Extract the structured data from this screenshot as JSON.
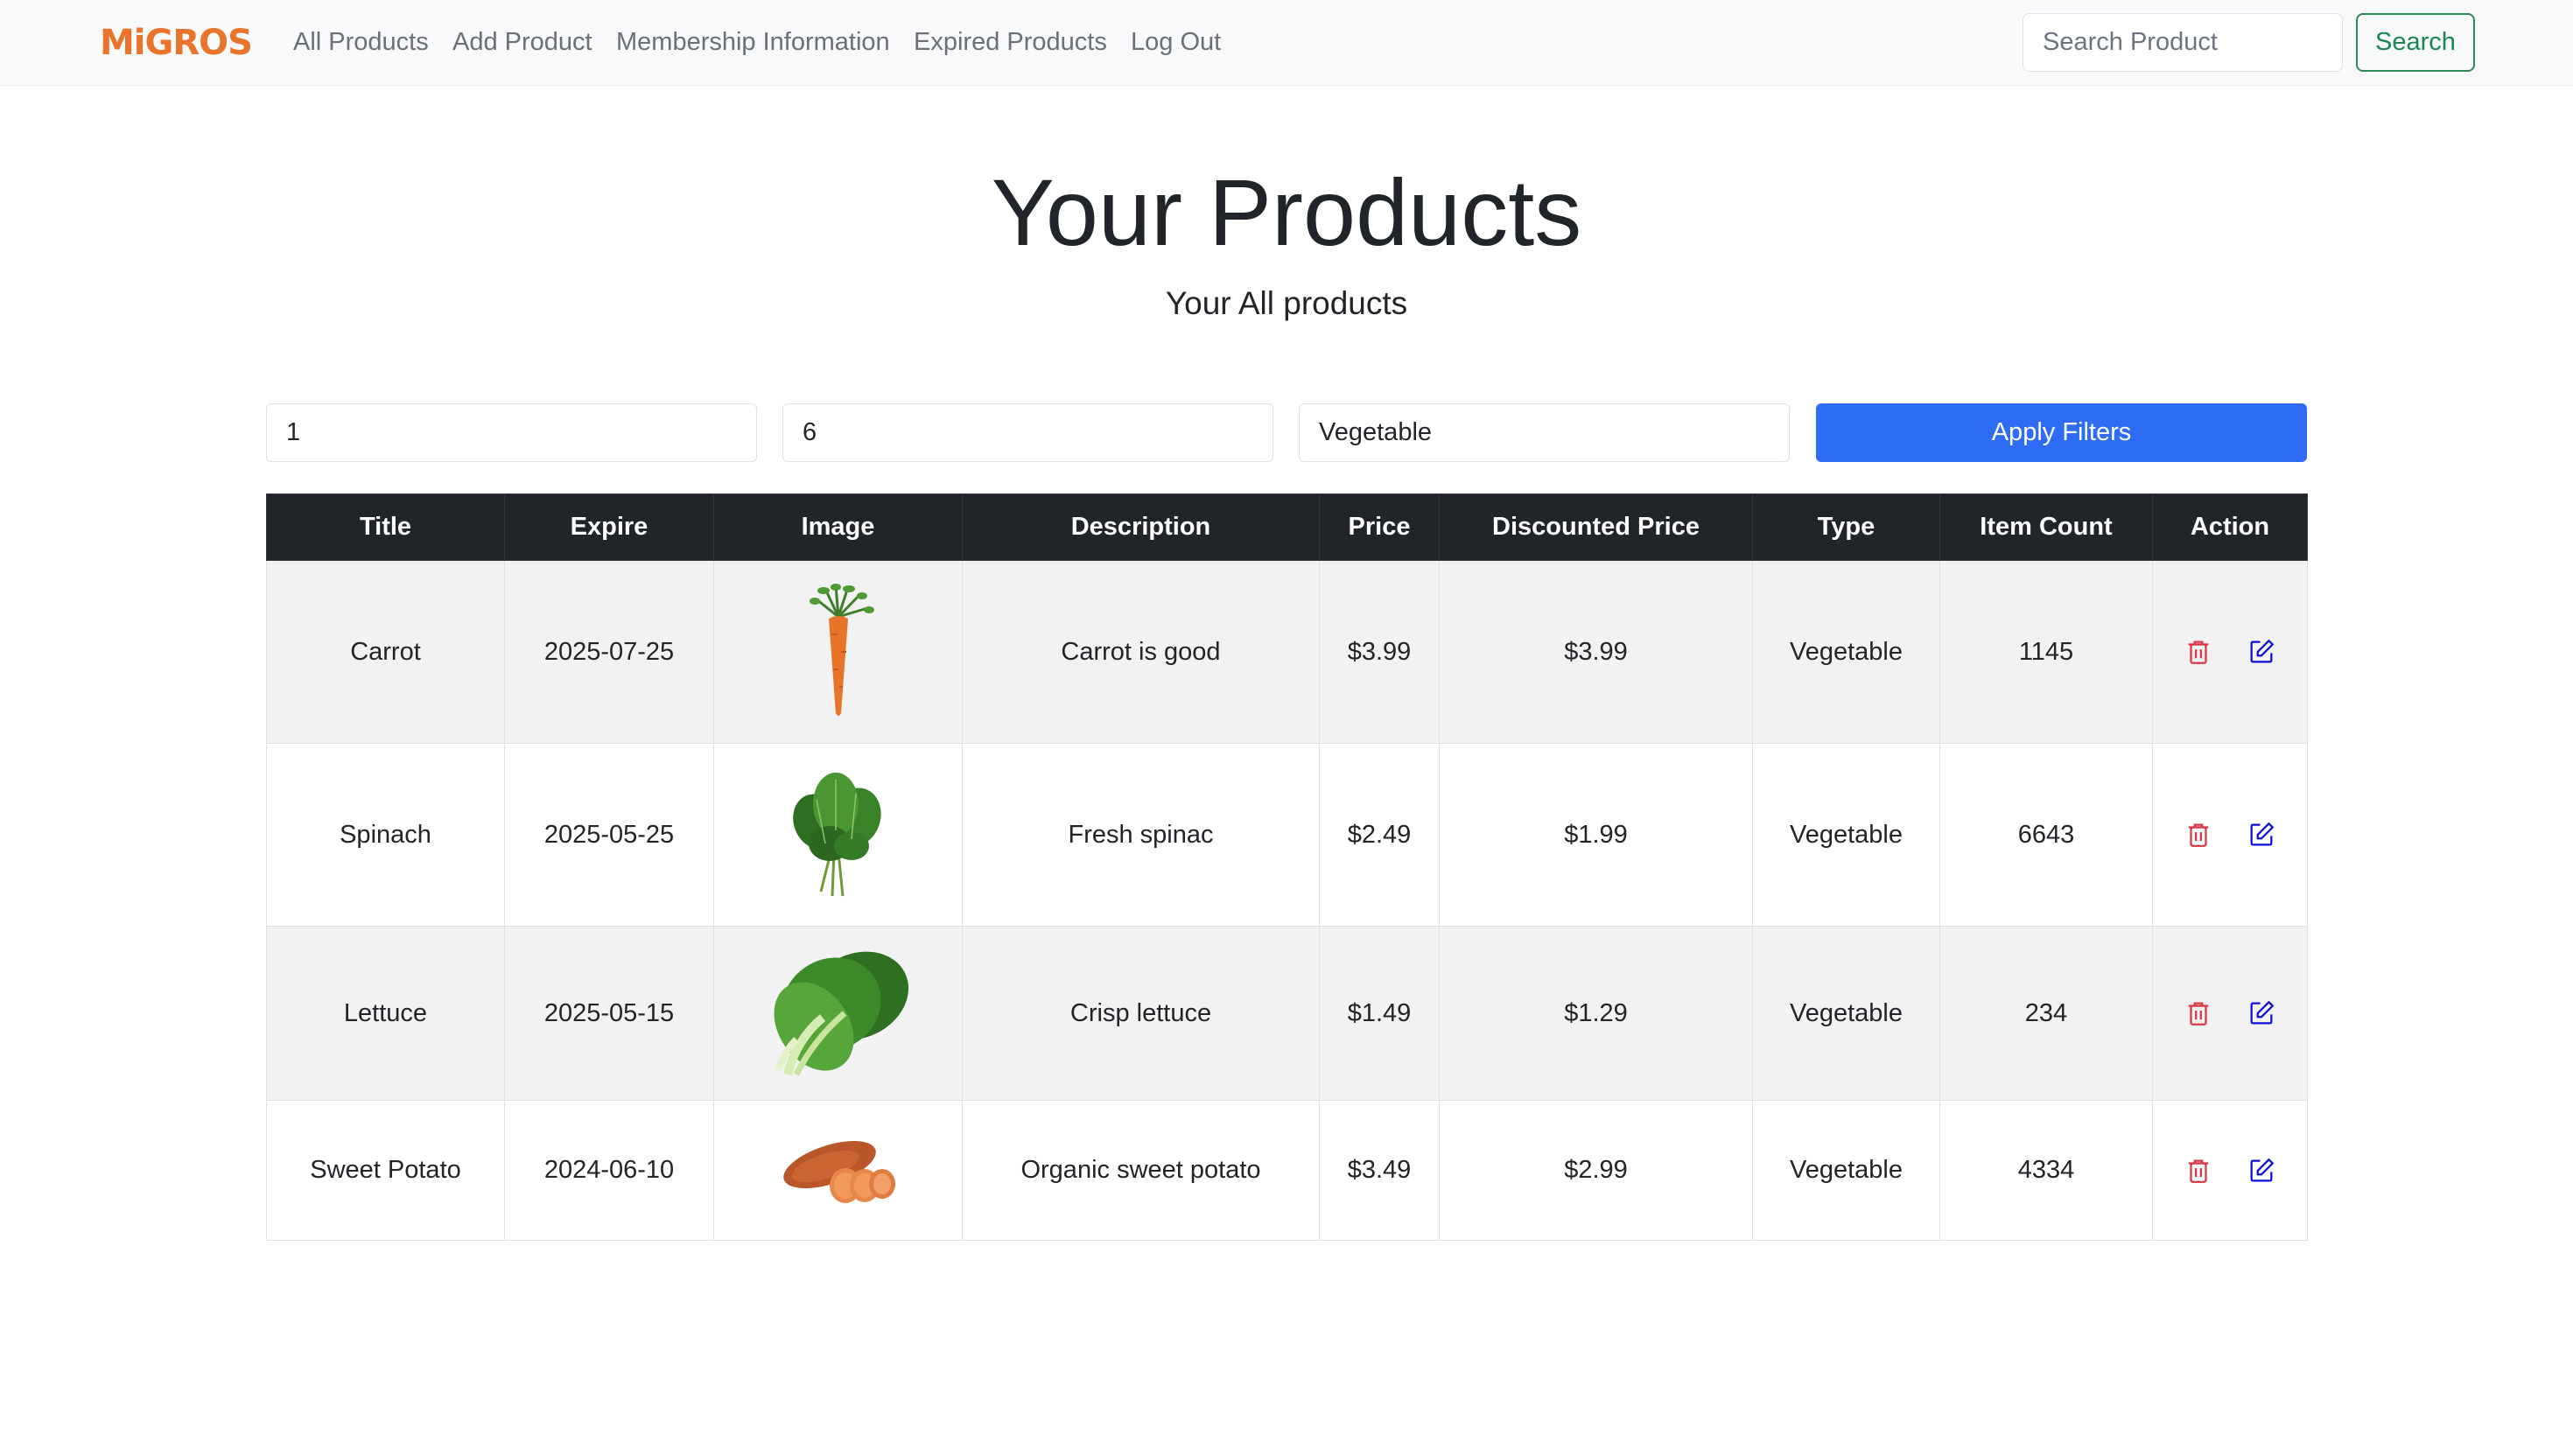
{
  "navbar": {
    "brand": "MiGROS",
    "links": [
      "All Products",
      "Add Product",
      "Membership Information",
      "Expired Products",
      "Log Out"
    ],
    "search_placeholder": "Search Product",
    "search_label": "Search"
  },
  "header": {
    "title": "Your Products",
    "subtitle": "Your All products"
  },
  "filters": {
    "min_value": "1",
    "max_value": "6",
    "type_value": "Vegetable",
    "apply_label": "Apply Filters"
  },
  "table": {
    "headers": [
      "Title",
      "Expire",
      "Image",
      "Description",
      "Price",
      "Discounted Price",
      "Type",
      "Item Count",
      "Action"
    ],
    "rows": [
      {
        "title": "Carrot",
        "expire": "2025-07-25",
        "image": "carrot-image",
        "description": "Carrot is good",
        "price": "$3.99",
        "discounted_price": "$3.99",
        "type": "Vegetable",
        "item_count": "1145"
      },
      {
        "title": "Spinach",
        "expire": "2025-05-25",
        "image": "spinach-image",
        "description": "Fresh spinac",
        "price": "$2.49",
        "discounted_price": "$1.99",
        "type": "Vegetable",
        "item_count": "6643"
      },
      {
        "title": "Lettuce",
        "expire": "2025-05-15",
        "image": "lettuce-image",
        "description": "Crisp lettuce",
        "price": "$1.49",
        "discounted_price": "$1.29",
        "type": "Vegetable",
        "item_count": "234"
      },
      {
        "title": "Sweet Potato",
        "expire": "2024-06-10",
        "image": "sweet-potato-image",
        "description": "Organic sweet potato",
        "price": "$3.49",
        "discounted_price": "$2.99",
        "type": "Vegetable",
        "item_count": "4334"
      }
    ]
  },
  "icons": {
    "delete": "trash-icon",
    "edit": "edit-icon"
  },
  "colors": {
    "brand": "#e8752b",
    "primary": "#2f6cf5",
    "success": "#198754",
    "danger": "#dc3545",
    "edit": "#0d0dd8",
    "table_header": "#212529"
  }
}
